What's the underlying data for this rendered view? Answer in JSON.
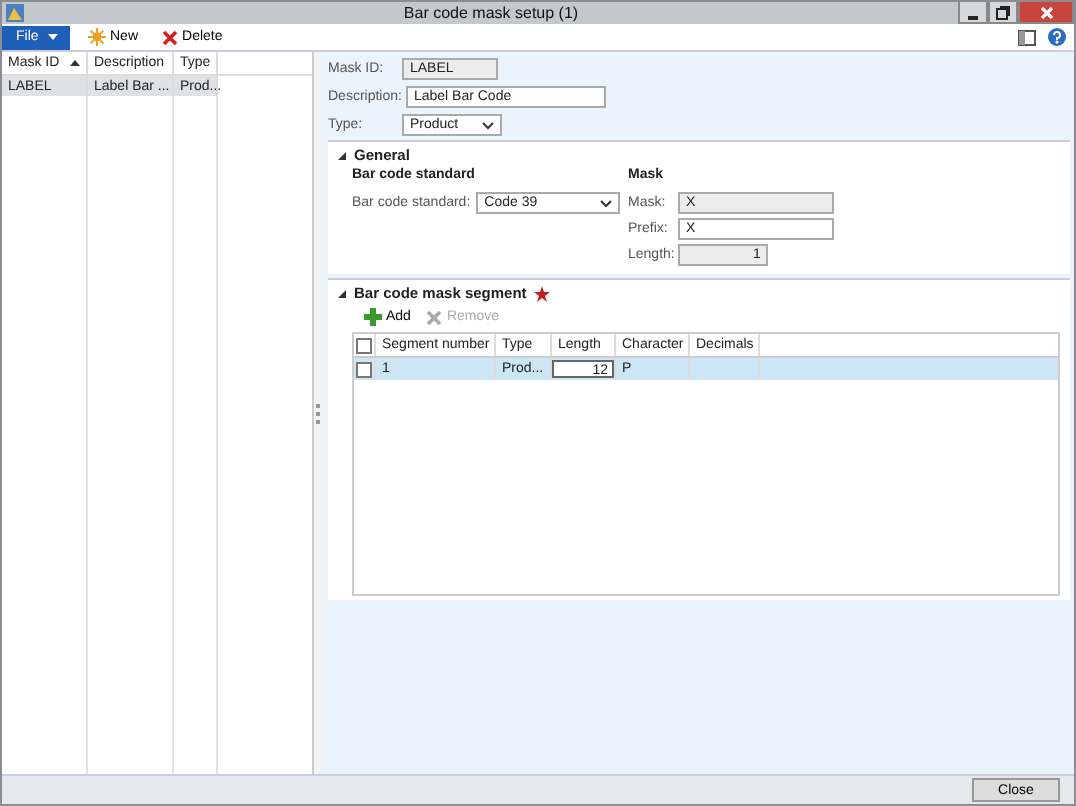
{
  "window": {
    "title": "Bar code mask setup (1)"
  },
  "toolbar": {
    "file_menu": "File",
    "buttons": [
      {
        "kind": "new",
        "label": "New"
      },
      {
        "kind": "delete",
        "label": "Delete"
      }
    ]
  },
  "list": {
    "columns": [
      {
        "label": "Mask ID",
        "sorted": true
      },
      {
        "label": "Description",
        "sorted": false
      },
      {
        "label": "Type",
        "sorted": false
      }
    ],
    "rows": [
      {
        "cells": [
          "LABEL",
          "Label Bar ...",
          "Prod..."
        ],
        "selected": true
      }
    ]
  },
  "header_fields": [
    {
      "label": "Mask ID:",
      "value": "LABEL",
      "kind": "readonly"
    },
    {
      "label": "Description:",
      "value": "Label Bar Code",
      "kind": "text"
    },
    {
      "label": "Type:",
      "value": "Product",
      "kind": "dropdown"
    }
  ],
  "general": {
    "title": "General",
    "expanded": true,
    "groups": [
      {
        "title": "Bar code standard",
        "fields": [
          {
            "label": "Bar code standard:",
            "value": "Code 39",
            "kind": "dropdown"
          }
        ]
      },
      {
        "title": "Mask",
        "fields": [
          {
            "label": "Mask:",
            "value": "X",
            "kind": "readonly"
          },
          {
            "label": "Prefix:",
            "value": "X",
            "kind": "text"
          },
          {
            "label": "Length:",
            "value": "1",
            "kind": "readonly-number"
          }
        ]
      }
    ]
  },
  "segment": {
    "title": "Bar code mask segment",
    "expanded": true,
    "required": true,
    "all_checked": false,
    "buttons": [
      {
        "kind": "add",
        "label": "Add",
        "disabled": false
      },
      {
        "kind": "remove",
        "label": "Remove",
        "disabled": true
      }
    ],
    "columns": [
      "Segment number",
      "Type",
      "Length",
      "Character",
      "Decimals"
    ],
    "rows": [
      {
        "cells": [
          "1",
          "Prod...",
          "12",
          "P",
          ""
        ],
        "selected": true,
        "checked": false
      }
    ]
  },
  "footer": {
    "buttons": [
      "Close"
    ]
  }
}
